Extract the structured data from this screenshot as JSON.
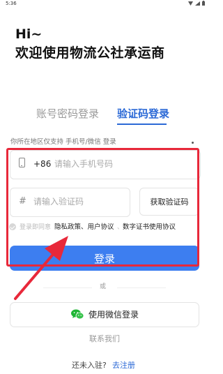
{
  "status_bar": {
    "time": "5:36"
  },
  "header": {
    "greeting": "Hi~",
    "welcome": "欢迎使用物流公社承运商"
  },
  "tabs": [
    {
      "label": "账号密码登录",
      "active": false
    },
    {
      "label": "验证码登录",
      "active": true
    }
  ],
  "region_note": "你所在地区仅支持 手机号/微信 登录",
  "phone": {
    "country_code": "+86",
    "placeholder": "请输入手机号码",
    "value": ""
  },
  "code": {
    "placeholder": "请输入验证码",
    "value": "",
    "get_code_label": "获取验证码"
  },
  "agreement": {
    "prefix": "登录即同意",
    "links": "隐私政策、用户协议",
    "extra": "、",
    "links2": "数字证书使用协议"
  },
  "login_label": "登录",
  "divider_text": "或",
  "wechat_label": "使用微信登录",
  "contact_label": "联系我们",
  "register": {
    "prefix": "还未入驻?",
    "link": "去注册"
  },
  "colors": {
    "accent": "#3d7ef0",
    "tab_active": "#2b69d6",
    "highlight": "#e8283a",
    "wechat": "#1fb534"
  }
}
